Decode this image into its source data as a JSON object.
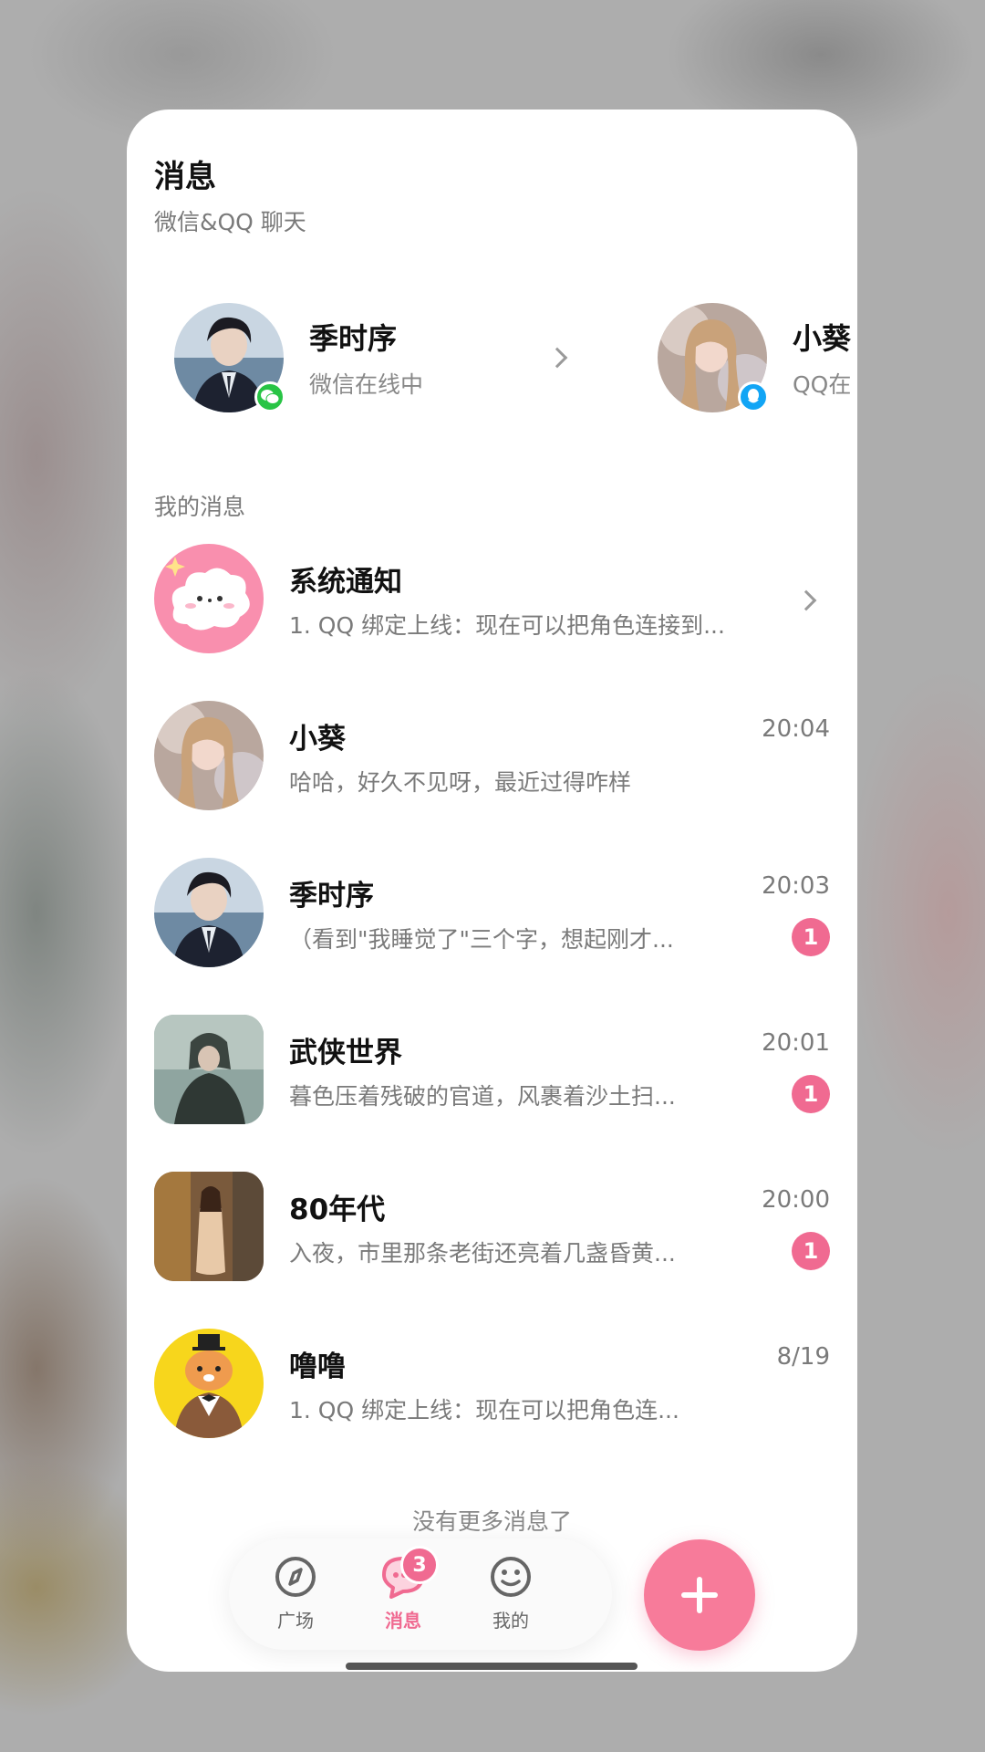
{
  "header": {
    "title": "消息"
  },
  "sections": {
    "linked_chats": "微信&QQ 聊天",
    "my_messages": "我的消息"
  },
  "linked_contacts": [
    {
      "name": "季时序",
      "status": "微信在线中",
      "platform": "wechat",
      "platform_color": "#28c445"
    },
    {
      "name": "小葵",
      "status": "QQ在",
      "platform": "qq",
      "platform_color": "#12a5f5"
    }
  ],
  "messages": [
    {
      "name": "系统通知",
      "preview": "1. QQ 绑定上线：现在可以把角色连接到...",
      "time": "",
      "unread": ""
    },
    {
      "name": "小葵",
      "preview": "哈哈，好久不见呀，最近过得咋样",
      "time": "20:04",
      "unread": ""
    },
    {
      "name": "季时序",
      "preview": "（看到\"我睡觉了\"三个字，想起刚才...",
      "time": "20:03",
      "unread": "1"
    },
    {
      "name": "武侠世界",
      "preview": "暮色压着残破的官道，风裹着沙土扫...",
      "time": "20:01",
      "unread": "1"
    },
    {
      "name": "80年代",
      "preview": "入夜，市里那条老街还亮着几盏昏黄...",
      "time": "20:00",
      "unread": "1"
    },
    {
      "name": "噜噜",
      "preview": "1. QQ 绑定上线：现在可以把角色连...",
      "time": "8/19",
      "unread": ""
    }
  ],
  "footer_note": "没有更多消息了",
  "tabbar": {
    "tabs": [
      {
        "label": "广场",
        "icon": "compass-icon"
      },
      {
        "label": "消息",
        "icon": "chat-bubble-icon",
        "badge": "3",
        "active": true
      },
      {
        "label": "我的",
        "icon": "smiley-icon"
      }
    ]
  },
  "colors": {
    "accent": "#f06a91",
    "fab": "#f77b9a"
  }
}
